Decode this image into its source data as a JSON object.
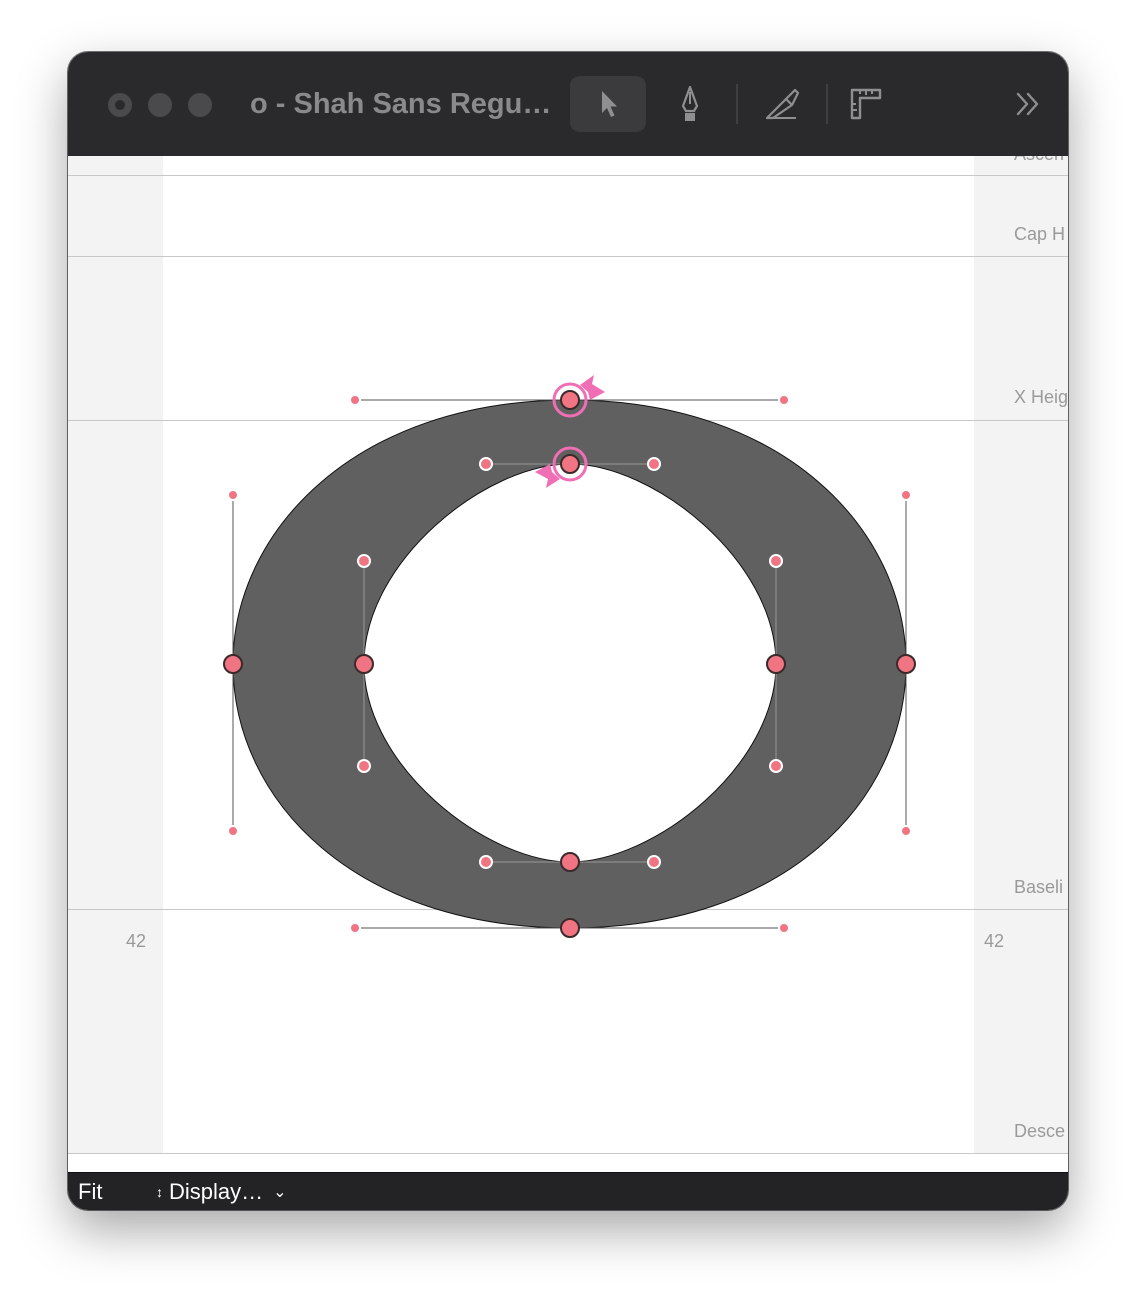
{
  "window": {
    "title": "o - Shah Sans Regu…"
  },
  "toolbar": {
    "tools": [
      {
        "name": "pointer-tool",
        "icon": "arrow-pointer-icon",
        "active": true
      },
      {
        "name": "pen-tool",
        "icon": "pen-nib-icon",
        "active": false
      },
      {
        "name": "knife-tool",
        "icon": "knife-icon",
        "active": false
      },
      {
        "name": "ruler-tool",
        "icon": "ruler-icon",
        "active": false
      }
    ],
    "overflow_icon": "double-chevron-right-icon"
  },
  "metrics": {
    "ascender": "Ascen",
    "cap_height": "Cap H",
    "x_height": "X Heig",
    "baseline": "Baseli",
    "descender": "Desce"
  },
  "sidebearings": {
    "left": "42",
    "right": "42"
  },
  "glyph": {
    "name": "o",
    "fill_color": "#606060",
    "point_color": "#f07482",
    "selection_color": "#f06fb4"
  },
  "bottom_bar": {
    "zoom": "Fit",
    "display_menu": "Display…"
  }
}
